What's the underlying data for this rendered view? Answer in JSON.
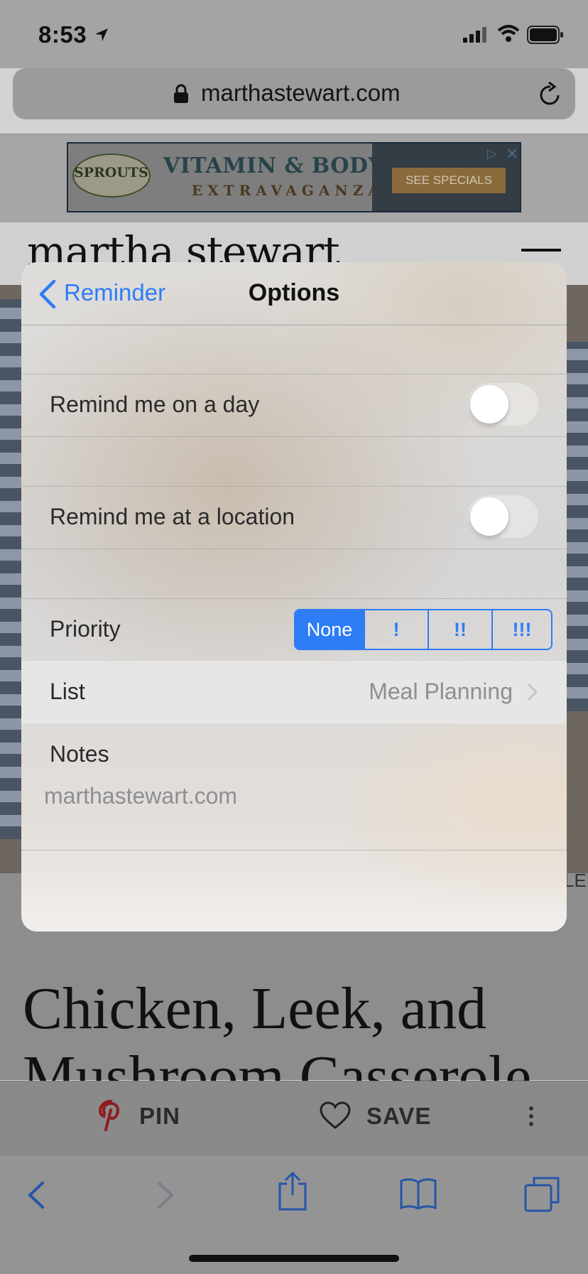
{
  "status_bar": {
    "time": "8:53"
  },
  "browser": {
    "url": "marthastewart.com"
  },
  "ad": {
    "logo": "SPROUTS",
    "headline": "VITAMIN & BODY CARE",
    "subheadline": "EXTRAVAGANZA",
    "cta": "SEE SPECIALS"
  },
  "site": {
    "brand": "martha stewart",
    "recipe_title": "Chicken, Leek, and Mushroom Casserole",
    "hero_edge_text": "LEE"
  },
  "share_bar": {
    "pin_label": "PIN",
    "save_label": "SAVE"
  },
  "sheet": {
    "back_label": "Reminder",
    "title": "Options",
    "remind_day_label": "Remind me on a day",
    "remind_day_on": false,
    "remind_location_label": "Remind me at a location",
    "remind_location_on": false,
    "priority_label": "Priority",
    "priority_options": [
      "None",
      "!",
      "!!",
      "!!!"
    ],
    "priority_selected": "None",
    "list_label": "List",
    "list_value": "Meal Planning",
    "notes_label": "Notes",
    "notes_text": "marthastewart.com"
  },
  "colors": {
    "accent": "#2e7cf6",
    "secondary_text": "#8e8e93"
  }
}
